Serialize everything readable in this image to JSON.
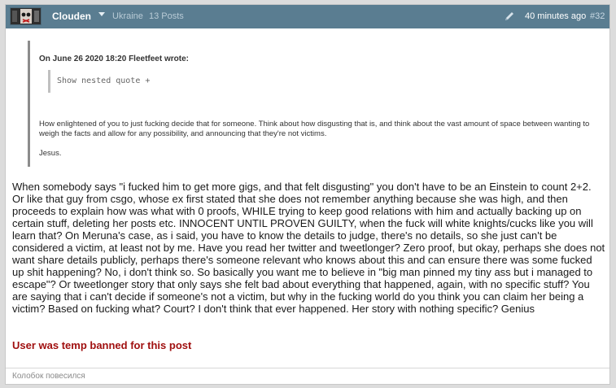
{
  "post": {
    "username": "Clouden",
    "country": "Ukraine",
    "post_count": "13 Posts",
    "timestamp": "40 minutes ago",
    "post_number": "#32",
    "header_color": "#5a7d91"
  },
  "quote": {
    "author_line": "On June 26 2020 18:20 Fleetfeet wrote:",
    "nested_toggle": "Show nested quote +",
    "text": "How enlightened of you to just fucking decide that for someone. Think about how disgusting that is, and think about the vast amount of space between wanting to weigh the facts and allow for any possibility, and announcing that they're not victims.",
    "sign": "Jesus."
  },
  "body": {
    "text": "When somebody says \"i fucked him to get more gigs, and that felt disgusting\" you don't have to be an Einstein to count 2+2. Or like that guy from csgo, whose ex first stated that she does not remember anything because she was high, and then proceeds to explain how was what with 0 proofs, WHILE trying to keep good relations with him and actually backing up on certain stuff, deleting her posts etc. INNOCENT UNTIL PROVEN GUILTY, when the fuck will white knights/cucks like you will learn that? On Meruna's case, as i said, you have to know the details to judge, there's no details, so she just can't be considered a victim, at least not by me. Have you read her twitter and tweetlonger? Zero proof, but okay, perhaps she does not want share details publicly, perhaps there's someone relevant who knows about this and can ensure there was some fucked up shit happening? No, i don't think so. So basically you want me to believe in \"big man pinned my tiny ass but i managed to escape\"? Or tweetlonger story that only says she felt bad about everything that happened, again, with no specific stuff? You are saying that i can't decide if someone's not a victim, but why in the fucking world do you think you can claim her being a victim? Based on fucking what? Court? I don't think that ever happened. Her story with nothing specific? Genius",
    "ban_notice": "User was temp banned for this post"
  },
  "signature": "Колобок повесился",
  "icons": {
    "edit": "pencil-icon",
    "menu": "chevron-down-icon",
    "avatar": "avatar"
  }
}
